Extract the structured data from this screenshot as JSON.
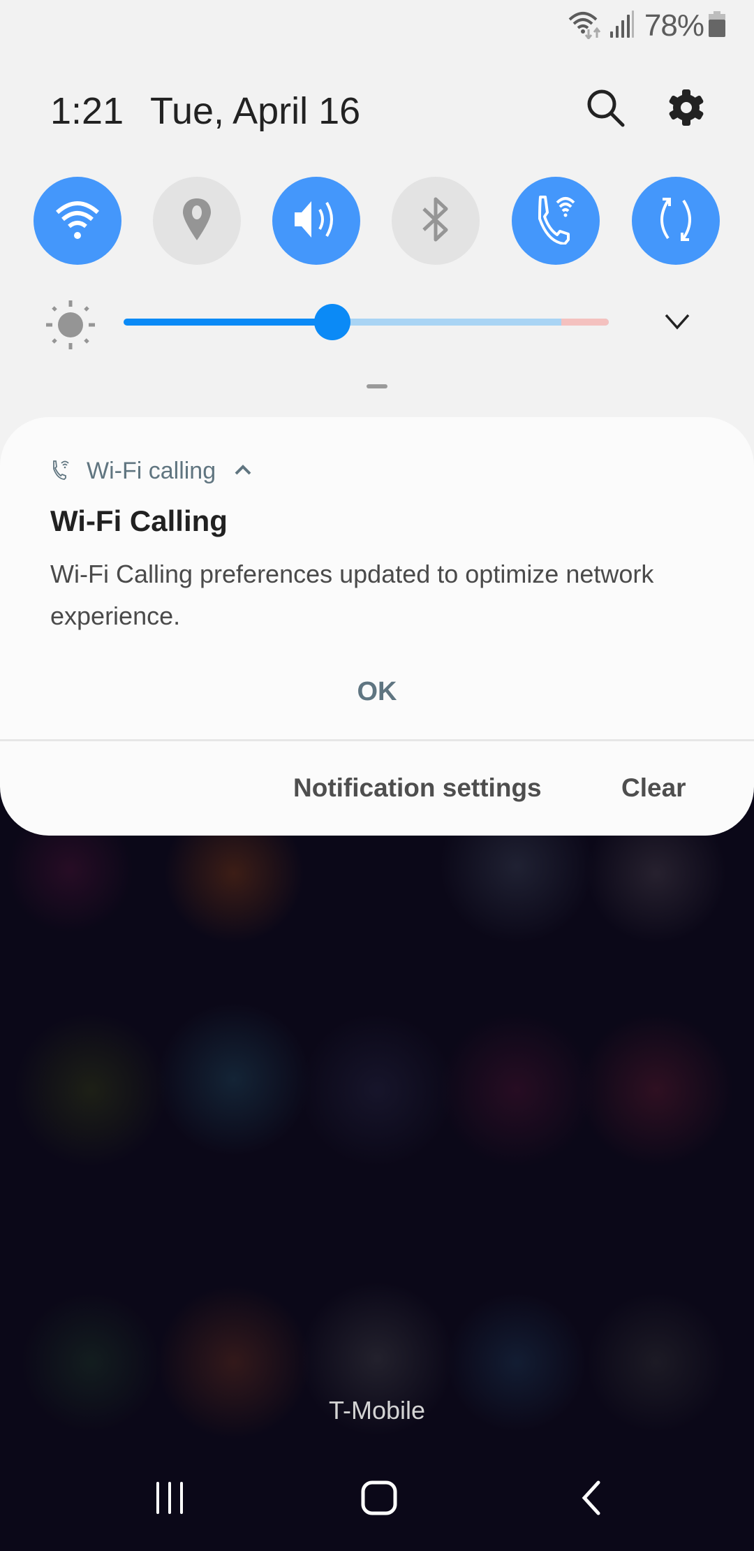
{
  "status_bar": {
    "icons": [
      "wifi-data-activity-icon",
      "cellular-signal-icon",
      "battery-icon"
    ],
    "battery_percent": "78%",
    "battery_level": 0.78
  },
  "header": {
    "time": "1:21",
    "date": "Tue, April 16",
    "icons": [
      "search-icon",
      "gear-icon"
    ]
  },
  "quick_toggles": [
    {
      "name": "Wi-Fi",
      "icon": "wifi-icon",
      "state": "on"
    },
    {
      "name": "Location",
      "icon": "location-pin-icon",
      "state": "off"
    },
    {
      "name": "Sound",
      "icon": "speaker-icon",
      "state": "on"
    },
    {
      "name": "Bluetooth",
      "icon": "bluetooth-icon",
      "state": "off"
    },
    {
      "name": "Wi-Fi Calling",
      "icon": "wifi-calling-icon",
      "state": "on"
    },
    {
      "name": "Auto rotate",
      "icon": "rotate-icon",
      "state": "on"
    }
  ],
  "brightness": {
    "level_percent": 43,
    "icon": "sun-icon",
    "expand_icon": "chevron-down-icon"
  },
  "colors": {
    "accent": "#4497fb",
    "slider": "#0b8af6",
    "toggle_off": "#e3e3e3",
    "panel_bg": "#f2f2f2",
    "app_name": "#607580"
  },
  "notification": {
    "app_icon": "wifi-calling-icon",
    "app_name": "Wi-Fi calling",
    "title": "Wi-Fi Calling",
    "body": "Wi-Fi Calling preferences updated to optimize network experience.",
    "action": "OK",
    "footer_buttons": {
      "settings": "Notification settings",
      "clear": "Clear"
    }
  },
  "carrier": "T-Mobile",
  "nav_bar": [
    "recents-icon",
    "home-icon",
    "back-icon"
  ]
}
